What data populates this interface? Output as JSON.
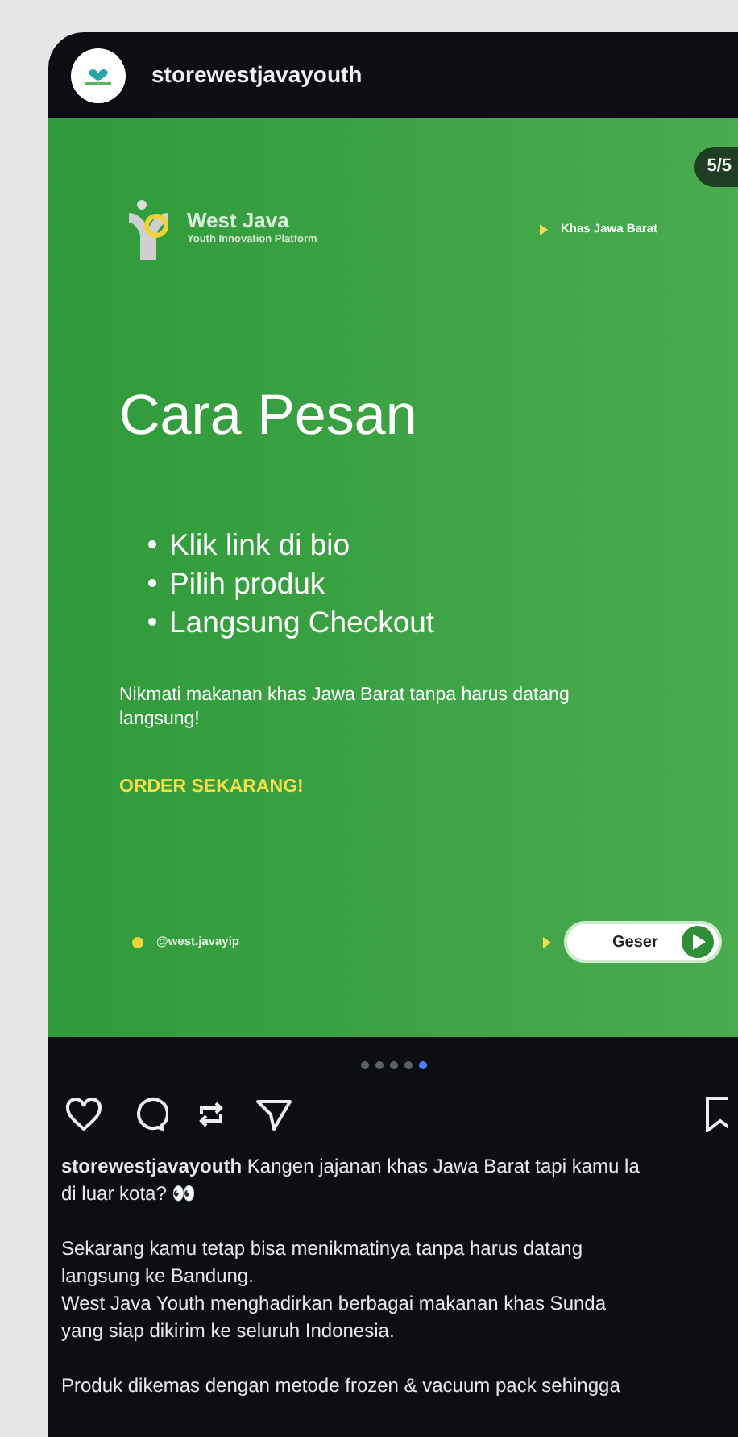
{
  "header": {
    "username": "storewestjavayouth"
  },
  "slide": {
    "counter": "5/5",
    "brand": {
      "name": "West Java",
      "tagline": "Youth Innovation Platform"
    },
    "tag": "Khas Jawa Barat",
    "title": "Cara Pesan",
    "bullets": [
      "Klik link di bio",
      "Pilih produk",
      "Langsung Checkout"
    ],
    "text": "Nikmati makanan khas Jawa Barat tanpa harus datang langsung!",
    "cta": "ORDER SEKARANG!",
    "handle": "@west.javayip",
    "button": "Geser"
  },
  "dots": [
    {
      "selected": false
    },
    {
      "selected": false
    },
    {
      "selected": false
    },
    {
      "selected": false
    },
    {
      "selected": true
    }
  ],
  "caption": {
    "username": "storewestjavayouth",
    "paragraphs": [
      [
        "Kangen jajanan khas Jawa Barat tapi kamu la",
        "di luar kota? 👀"
      ],
      [
        "Sekarang kamu tetap bisa menikmatinya tanpa harus datang",
        "langsung ke Bandung.",
        "West Java Youth menghadirkan berbagai makanan khas Sunda",
        "yang siap dikirim ke seluruh Indonesia."
      ],
      [
        "Produk dikemas dengan metode frozen & vacuum pack sehingga"
      ]
    ]
  }
}
